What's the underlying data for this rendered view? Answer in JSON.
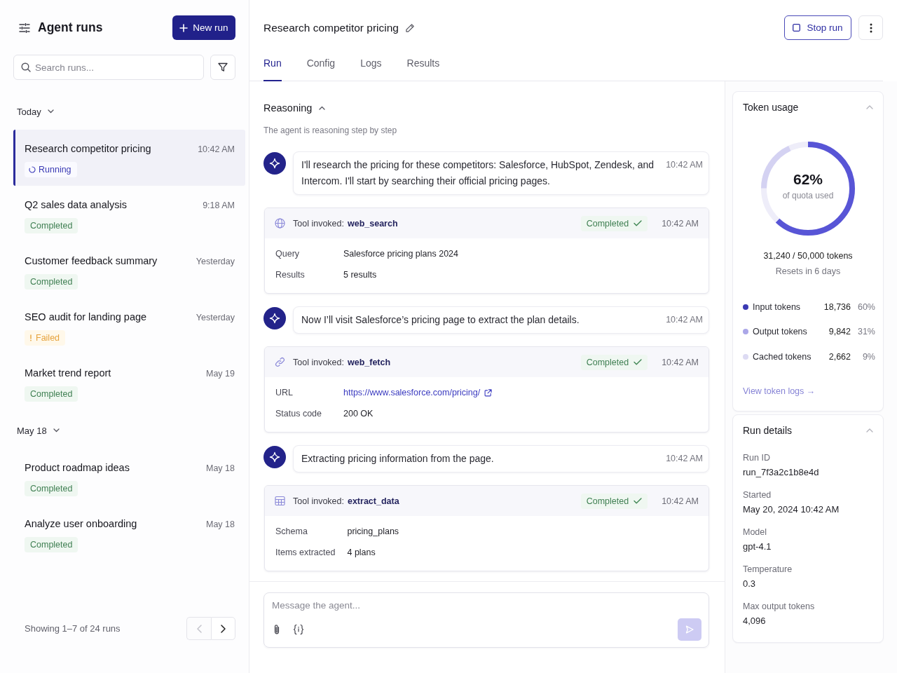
{
  "sidebar": {
    "title": "Agent runs",
    "new_run_button": "New run",
    "search": {
      "placeholder": "Search runs..."
    },
    "groups": [
      {
        "label": "Today",
        "expanded": true,
        "runs": [
          {
            "title": "Research competitor pricing",
            "time": "10:42 AM",
            "status": {
              "label": "Running",
              "kind": "running"
            },
            "selected": true
          },
          {
            "title": "Q2 sales data analysis",
            "time": "9:18 AM",
            "status": {
              "label": "Completed",
              "kind": "completed"
            },
            "selected": false
          },
          {
            "title": "Customer feedback summary",
            "time": "Yesterday",
            "status": {
              "label": "Completed",
              "kind": "completed"
            },
            "selected": false
          },
          {
            "title": "SEO audit for landing page",
            "time": "Yesterday",
            "status": {
              "label": "Failed",
              "kind": "failed"
            },
            "selected": false
          },
          {
            "title": "Market trend report",
            "time": "May 19",
            "status": {
              "label": "Completed",
              "kind": "completed"
            },
            "selected": false
          }
        ]
      },
      {
        "label": "May 18",
        "expanded": true,
        "runs": [
          {
            "title": "Product roadmap ideas",
            "time": "May 18",
            "status": {
              "label": "Completed",
              "kind": "completed"
            },
            "selected": false
          },
          {
            "title": "Analyze user onboarding",
            "time": "May 18",
            "status": {
              "label": "Completed",
              "kind": "completed"
            },
            "selected": false
          }
        ]
      }
    ],
    "footer": "Showing 1–7 of 24 runs",
    "pager": {
      "prev_disabled": true,
      "next_disabled": false
    }
  },
  "header": {
    "title": "Research competitor pricing",
    "stop_button": "Stop run"
  },
  "tabs": [
    {
      "label": "Run",
      "selected": true
    },
    {
      "label": "Config",
      "selected": false
    },
    {
      "label": "Logs",
      "selected": false
    },
    {
      "label": "Results",
      "selected": false
    }
  ],
  "reasoning": {
    "title": "Reasoning",
    "expanded": true,
    "subtitle": "The agent is reasoning step by step",
    "steps": [
      {
        "kind": "message",
        "text": "I'll research the pricing for these competitors: Salesforce, HubSpot, Zendesk, and Intercom. I'll start by searching their official pricing pages.",
        "time": "10:42 AM"
      },
      {
        "kind": "tool",
        "label": "Tool invoked:",
        "tool": "web_search",
        "status": {
          "label": "Completed",
          "kind": "completed"
        },
        "time": "10:42 AM",
        "fields": [
          {
            "label": "Query",
            "value": "Salesforce pricing plans 2024",
            "kind": "text"
          },
          {
            "label": "Results",
            "value": "5 results",
            "kind": "text"
          }
        ]
      },
      {
        "kind": "message",
        "text": "Now I’ll visit Salesforce’s pricing page to extract the plan details.",
        "time": "10:42 AM"
      },
      {
        "kind": "tool",
        "label": "Tool invoked:",
        "tool": "web_fetch",
        "status": {
          "label": "Completed",
          "kind": "completed"
        },
        "time": "10:42 AM",
        "fields": [
          {
            "label": "URL",
            "value": "https://www.salesforce.com/pricing/",
            "kind": "link"
          },
          {
            "label": "Status code",
            "value": "200 OK",
            "kind": "text"
          }
        ]
      },
      {
        "kind": "message",
        "text": "Extracting pricing information from the page.",
        "time": "10:42 AM"
      },
      {
        "kind": "tool",
        "label": "Tool invoked:",
        "tool": "extract_data",
        "status": {
          "label": "Completed",
          "kind": "completed"
        },
        "time": "10:42 AM",
        "fields": [
          {
            "label": "Schema",
            "value": "pricing_plans",
            "kind": "text"
          },
          {
            "label": "Items extracted",
            "value": "4 plans",
            "kind": "text"
          }
        ]
      }
    ]
  },
  "composer": {
    "placeholder": "Message the agent...",
    "send_disabled": true
  },
  "token_usage": {
    "title": "Token usage",
    "expanded": true,
    "level": 0.62,
    "percent": "62%",
    "caption": "of quota used",
    "total": "31,240 / 50,000 tokens",
    "reset": "Resets in 6 days",
    "breakdown": [
      {
        "label": "Input tokens",
        "value": "18,736",
        "percent": "60%",
        "color": "#3b3ab3"
      },
      {
        "label": "Output tokens",
        "value": "9,842",
        "percent": "31%",
        "color": "#aba7e8"
      },
      {
        "label": "Cached tokens",
        "value": "2,662",
        "percent": "9%",
        "color": "#dddbf3"
      }
    ],
    "link": "View token logs →"
  },
  "run_details": {
    "title": "Run details",
    "expanded": true,
    "items": [
      {
        "label": "Run ID",
        "value": "run_7f3a2c1b8e4d"
      },
      {
        "label": "Started",
        "value": "May 20, 2024 10:42 AM"
      },
      {
        "label": "Model",
        "value": "gpt-4.1"
      },
      {
        "label": "Temperature",
        "value": "0.3"
      },
      {
        "label": "Max output tokens",
        "value": "4,096"
      }
    ]
  }
}
